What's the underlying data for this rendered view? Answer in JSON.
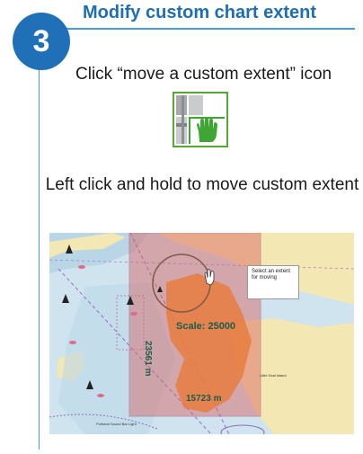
{
  "step": {
    "number": "3",
    "title": "Modify custom chart extent"
  },
  "instructions": {
    "line1": "Click “move a custom extent” icon",
    "line2": "Left click and hold to move custom extent"
  },
  "tool_icon": {
    "name": "move-custom-extent-icon",
    "accent": "#3fa535"
  },
  "map": {
    "tooltip": "Select an extent for moving",
    "scale_label": "Scale: 25000",
    "height_label": "23561 m",
    "width_label": "15723 m",
    "place_labels": [
      "Little Deal Island",
      "Portland Sound Bar Light"
    ]
  },
  "colors": {
    "header_blue": "#1f6eb3",
    "step_circle": "#2070b8",
    "land": "#f3e7b3",
    "extent_fill": "#d95d5d"
  }
}
